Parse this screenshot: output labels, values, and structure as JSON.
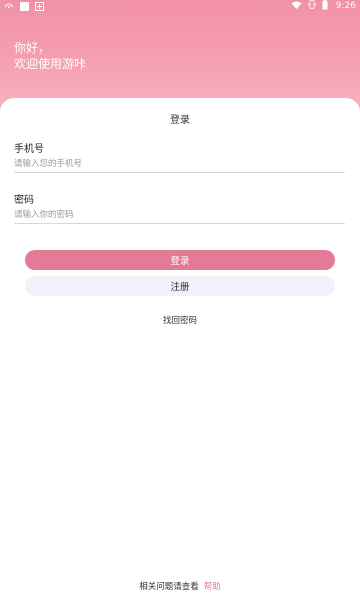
{
  "status_bar": {
    "time": "9:26",
    "icons": [
      "notification-icon",
      "square-icon",
      "plus-icon",
      "wifi-icon",
      "vibrate-icon",
      "battery-icon"
    ]
  },
  "greeting": {
    "line1": "你好，",
    "line2": "欢迎使用游咔"
  },
  "card": {
    "title": "登录",
    "phone": {
      "label": "手机号",
      "placeholder": "请输入您的手机号"
    },
    "password": {
      "label": "密码",
      "placeholder": "请输入你的密码"
    },
    "login_button": "登录",
    "register_button": "注册",
    "forgot_link": "找回密码"
  },
  "footer": {
    "text": "相关问题请查看",
    "help_link": "帮助"
  },
  "colors": {
    "header_gradient_top": "#f291a6",
    "accent": "#e47a95",
    "register_bg": "#f3f1fb"
  }
}
